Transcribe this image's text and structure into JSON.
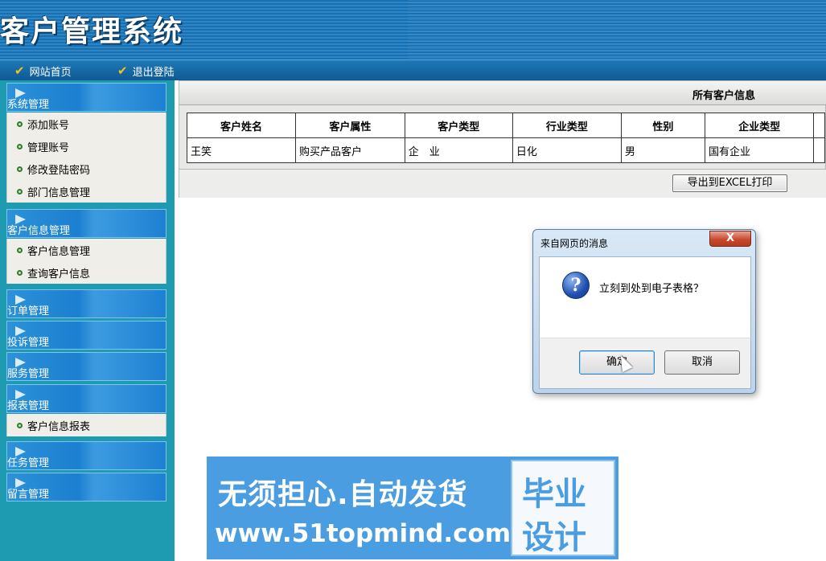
{
  "app": {
    "title": "客户管理系统"
  },
  "nav": {
    "home": "网站首页",
    "logout": "退出登陆"
  },
  "sidebar": {
    "groups": [
      {
        "label": "系统管理",
        "items": [
          "添加账号",
          "管理账号",
          "修改登陆密码",
          "部门信息管理"
        ]
      },
      {
        "label": "客户信息管理",
        "items": [
          "客户信息管理",
          "查询客户信息"
        ]
      },
      {
        "label": "订单管理",
        "items": []
      },
      {
        "label": "投诉管理",
        "items": []
      },
      {
        "label": "服务管理",
        "items": []
      },
      {
        "label": "报表管理",
        "items": [
          "客户信息报表"
        ]
      },
      {
        "label": "任务管理",
        "items": []
      },
      {
        "label": "留言管理",
        "items": []
      }
    ]
  },
  "main": {
    "caption": "所有客户信息",
    "table": {
      "headers": [
        "客户姓名",
        "客户属性",
        "客户类型",
        "行业类型",
        "性别",
        "企业类型"
      ],
      "rows": [
        [
          "王笑",
          "购买产品客户",
          "企　业",
          "日化",
          "男",
          "国有企业"
        ]
      ]
    },
    "export_button": "导出到EXCEL打印"
  },
  "dialog": {
    "title": "来自网页的消息",
    "close": "X",
    "icon_glyph": "?",
    "message": "立刻到处到电子表格？",
    "ok": "确定",
    "cancel": "取消"
  },
  "watermark": {
    "line1": "无须担心.自动发货",
    "line2": "www.51topmind.com",
    "badge1": "毕业",
    "badge2": "设计"
  },
  "colors": {
    "header": "#1a6fb0",
    "sidebar": "#1e9bb1",
    "menu_head": "#1c7fd0",
    "check": "#f6c21c"
  }
}
